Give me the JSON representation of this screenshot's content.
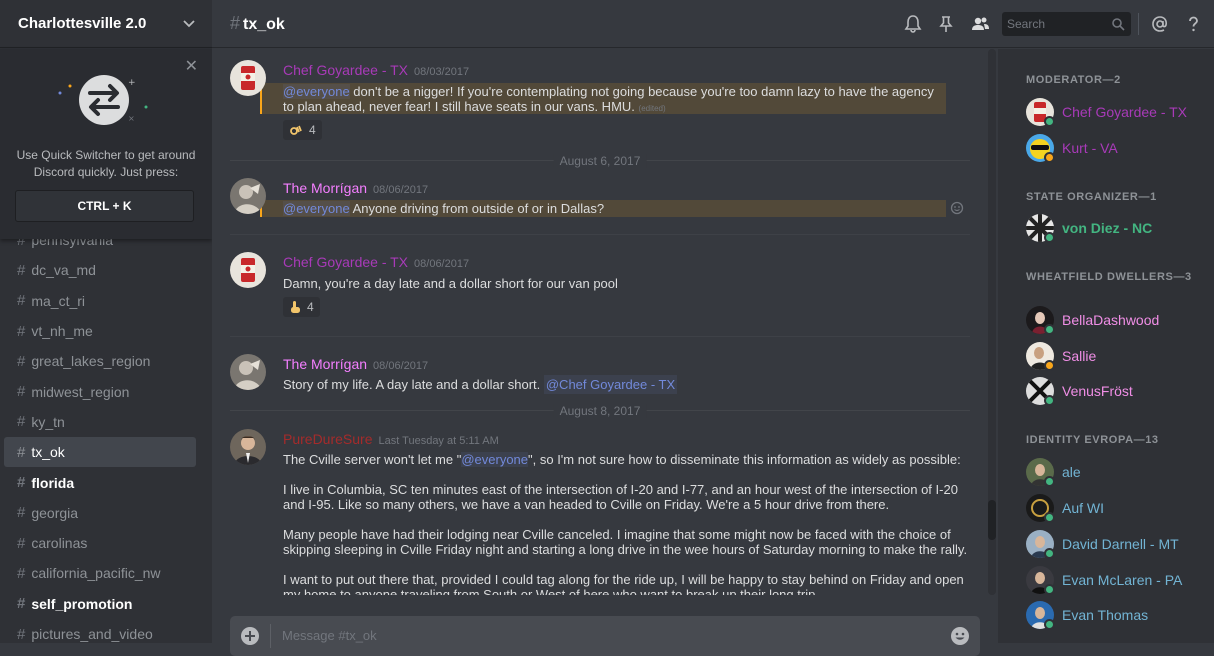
{
  "server": {
    "name": "Charlottesville 2.0"
  },
  "quick_switcher": {
    "text": "Use Quick Switcher to get around Discord quickly. Just press:",
    "shortcut": "CTRL + K"
  },
  "channels": [
    {
      "name": "pennsylvania",
      "state": "normal"
    },
    {
      "name": "dc_va_md",
      "state": "normal"
    },
    {
      "name": "ma_ct_ri",
      "state": "normal"
    },
    {
      "name": "vt_nh_me",
      "state": "normal"
    },
    {
      "name": "great_lakes_region",
      "state": "normal"
    },
    {
      "name": "midwest_region",
      "state": "normal"
    },
    {
      "name": "ky_tn",
      "state": "normal"
    },
    {
      "name": "tx_ok",
      "state": "active"
    },
    {
      "name": "florida",
      "state": "unread"
    },
    {
      "name": "georgia",
      "state": "normal"
    },
    {
      "name": "carolinas",
      "state": "normal"
    },
    {
      "name": "california_pacific_nw",
      "state": "normal"
    },
    {
      "name": "self_promotion",
      "state": "unread"
    },
    {
      "name": "pictures_and_video",
      "state": "normal"
    }
  ],
  "topbar": {
    "hash": "#",
    "channel": "tx_ok",
    "search_placeholder": "Search",
    "icons": [
      "bell-icon",
      "pin-icon",
      "members-icon",
      "search-icon",
      "mention-icon",
      "help-icon"
    ]
  },
  "colors": {
    "chef": "#a83ab8",
    "morrigan": "#f47fff",
    "puredure": "#a52b2b",
    "kurt": "#a83ab8",
    "vondiez": "#43b581",
    "wheatfield": "#f08ee6",
    "identity": "#72b4d4",
    "mention": "#7289da",
    "online": "#43b581",
    "idle": "#faa61a"
  },
  "messages": {
    "m1": {
      "author": "Chef Goyardee - TX",
      "time": "08/03/2017",
      "mention": "@everyone",
      "text": " don't be a nigger! If you're contemplating not going because you're too damn lazy to have the agency to plan ahead, never fear! I still have seats in our vans. HMU.",
      "edited": "(edited)",
      "reaction_count": "4"
    },
    "d1": "August 6, 2017",
    "m2": {
      "author": "The Morrígan",
      "time": "08/06/2017",
      "mention": "@everyone",
      "text": " Anyone driving from outside of or in Dallas?"
    },
    "m3": {
      "author": "Chef Goyardee - TX",
      "time": "08/06/2017",
      "text": "Damn, you're a day late and a dollar short for our van pool",
      "reaction_count": "4"
    },
    "m4": {
      "author": "The Morrígan",
      "time": "08/06/2017",
      "text": "Story of my life. A day late and a dollar short. ",
      "mention": "@Chef Goyardee - TX"
    },
    "d2": "August 8, 2017",
    "m5": {
      "author": "PureDureSure",
      "time": "Last Tuesday at 5:11 AM",
      "p1_a": "The  Cville server won't let me \"",
      "p1_mention": "@everyone",
      "p1_b": "\", so I'm not sure how to disseminate this information as widely as possible:",
      "p2": "I live in Columbia, SC ten minutes east of the intersection of I-20 and I-77, and an hour west of the intersection of I-20 and I-95. Like so many others, we have a van headed to Cville on Friday. We're a 5 hour drive from there.",
      "p3": "Many people have had their lodging near Cville canceled. I imagine that some might now be faced with the choice of skipping sleeping in Cville Friday night and starting a long drive in the wee hours of Saturday morning to make the rally.",
      "p4": "I want to put out there that, provided I could tag along for the ride up, I will be happy to stay behind on Friday and open my home to anyone traveling from South or West of here who want to break up their long trip."
    }
  },
  "composer": {
    "placeholder": "Message #tx_ok"
  },
  "members": {
    "groups": [
      {
        "title": "MODERATOR—2"
      },
      {
        "title": "STATE ORGANIZER—1"
      },
      {
        "title": "WHEATFIELD DWELLERS—3"
      },
      {
        "title": "IDENTITY EVROPA—13"
      }
    ],
    "list": [
      {
        "name": "Chef Goyardee - TX",
        "status": "online"
      },
      {
        "name": "Kurt - VA",
        "status": "idle"
      },
      {
        "name": "von Diez - NC",
        "status": "online"
      },
      {
        "name": "BellaDashwood",
        "status": "online"
      },
      {
        "name": "Sallie",
        "status": "idle"
      },
      {
        "name": "VenusFröst",
        "status": "online"
      },
      {
        "name": "ale",
        "status": "online"
      },
      {
        "name": "Auf WI",
        "status": "online"
      },
      {
        "name": "David Darnell - MT",
        "status": "online"
      },
      {
        "name": "Evan McLaren - PA",
        "status": "online"
      },
      {
        "name": "Evan Thomas",
        "status": "online"
      }
    ]
  }
}
